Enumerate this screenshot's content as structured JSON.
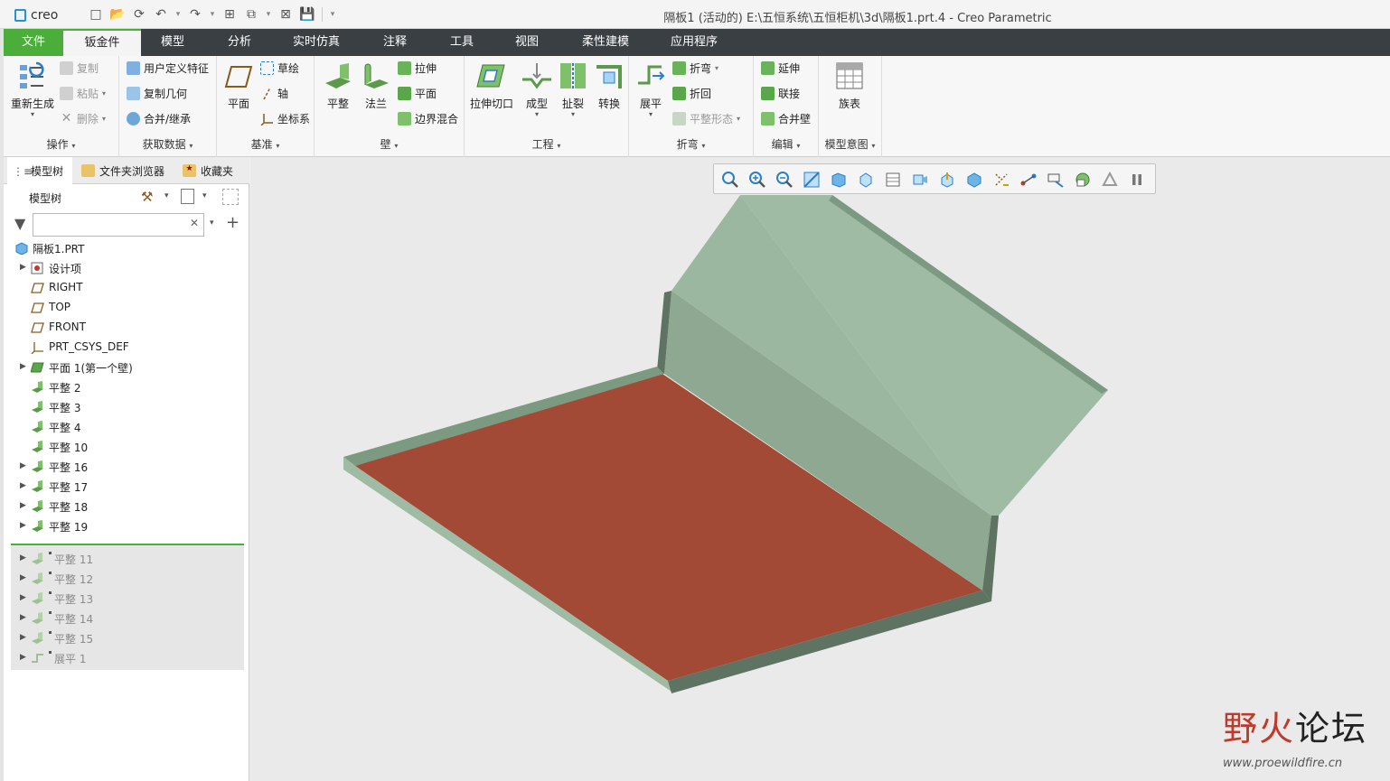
{
  "app": {
    "logo_text": "creo",
    "window_title": "隔板1 (活动的) E:\\五恒系统\\五恒柜机\\3d\\隔板1.prt.4 - Creo Parametric"
  },
  "tabs": [
    {
      "label": "文件"
    },
    {
      "label": "钣金件"
    },
    {
      "label": "模型"
    },
    {
      "label": "分析"
    },
    {
      "label": "实时仿真"
    },
    {
      "label": "注释"
    },
    {
      "label": "工具"
    },
    {
      "label": "视图"
    },
    {
      "label": "柔性建模"
    },
    {
      "label": "应用程序"
    }
  ],
  "ribbon": {
    "operations": {
      "label": "操作",
      "regen": "重新生成",
      "copy": "复制",
      "paste": "粘贴",
      "delete": "删除"
    },
    "get_data": {
      "label": "获取数据",
      "udf": "用户定义特征",
      "copy_geom": "复制几何",
      "merge": "合并/继承"
    },
    "datum": {
      "label": "基准",
      "plane": "平面",
      "sketch": "草绘",
      "axis": "轴",
      "csys": "坐标系"
    },
    "wall": {
      "label": "壁",
      "flat": "平整",
      "flange": "法兰",
      "extrude": "拉伸",
      "planar": "平面",
      "blend": "边界混合"
    },
    "engineering": {
      "label": "工程",
      "extrude_cut": "拉伸切口",
      "form": "成型",
      "rip": "扯裂",
      "convert": "转换"
    },
    "bends": {
      "label": "折弯",
      "unbend": "展平",
      "bend": "折弯",
      "bend_back": "折回",
      "flat_state": "平整形态"
    },
    "editing": {
      "label": "编辑",
      "extend": "延伸",
      "join": "联接",
      "merge_walls": "合并壁"
    },
    "model_intent": {
      "label": "模型意图",
      "family_table": "族表"
    }
  },
  "panel": {
    "tabs": [
      "模型树",
      "文件夹浏览器",
      "收藏夹"
    ],
    "tree_label": "模型树",
    "search_value": "",
    "tree": [
      {
        "label": "隔板1.PRT",
        "icon": "part-icon",
        "expand": false,
        "indent": 0
      },
      {
        "label": "设计项",
        "icon": "design-items-icon",
        "expand": true,
        "indent": 1
      },
      {
        "label": "RIGHT",
        "icon": "datum-plane-icon",
        "expand": false,
        "indent": 1
      },
      {
        "label": "TOP",
        "icon": "datum-plane-icon",
        "expand": false,
        "indent": 1
      },
      {
        "label": "FRONT",
        "icon": "datum-plane-icon",
        "expand": false,
        "indent": 1
      },
      {
        "label": "PRT_CSYS_DEF",
        "icon": "csys-icon",
        "expand": false,
        "indent": 1
      },
      {
        "label": "平面 1(第一个壁)",
        "icon": "planar-wall-icon",
        "expand": true,
        "indent": 1
      },
      {
        "label": "平整 2",
        "icon": "flat-wall-icon",
        "expand": false,
        "indent": 1
      },
      {
        "label": "平整 3",
        "icon": "flat-wall-icon",
        "expand": false,
        "indent": 1
      },
      {
        "label": "平整 4",
        "icon": "flat-wall-icon",
        "expand": false,
        "indent": 1
      },
      {
        "label": "平整 10",
        "icon": "flat-wall-icon",
        "expand": false,
        "indent": 1
      },
      {
        "label": "平整 16",
        "icon": "flat-wall-icon",
        "expand": true,
        "indent": 1
      },
      {
        "label": "平整 17",
        "icon": "flat-wall-icon",
        "expand": true,
        "indent": 1
      },
      {
        "label": "平整 18",
        "icon": "flat-wall-icon",
        "expand": true,
        "indent": 1
      },
      {
        "label": "平整 19",
        "icon": "flat-wall-icon",
        "expand": true,
        "indent": 1
      }
    ],
    "suppressed": [
      {
        "label": "平整 11",
        "icon": "flat-wall-icon"
      },
      {
        "label": "平整 12",
        "icon": "flat-wall-icon"
      },
      {
        "label": "平整 13",
        "icon": "flat-wall-icon"
      },
      {
        "label": "平整 14",
        "icon": "flat-wall-icon"
      },
      {
        "label": "平整 15",
        "icon": "flat-wall-icon"
      },
      {
        "label": "展平 1",
        "icon": "unbend-icon"
      }
    ]
  },
  "watermark": {
    "char1": "野",
    "char2": "火",
    "char3": "论坛",
    "url": "www.proewildfire.cn"
  },
  "colors": {
    "accent": "#4cae3a",
    "tabbar": "#3a3f44",
    "face_red": "#a34a36",
    "wall_green": "#9fbba4",
    "edge_green": "#7c9a82"
  }
}
